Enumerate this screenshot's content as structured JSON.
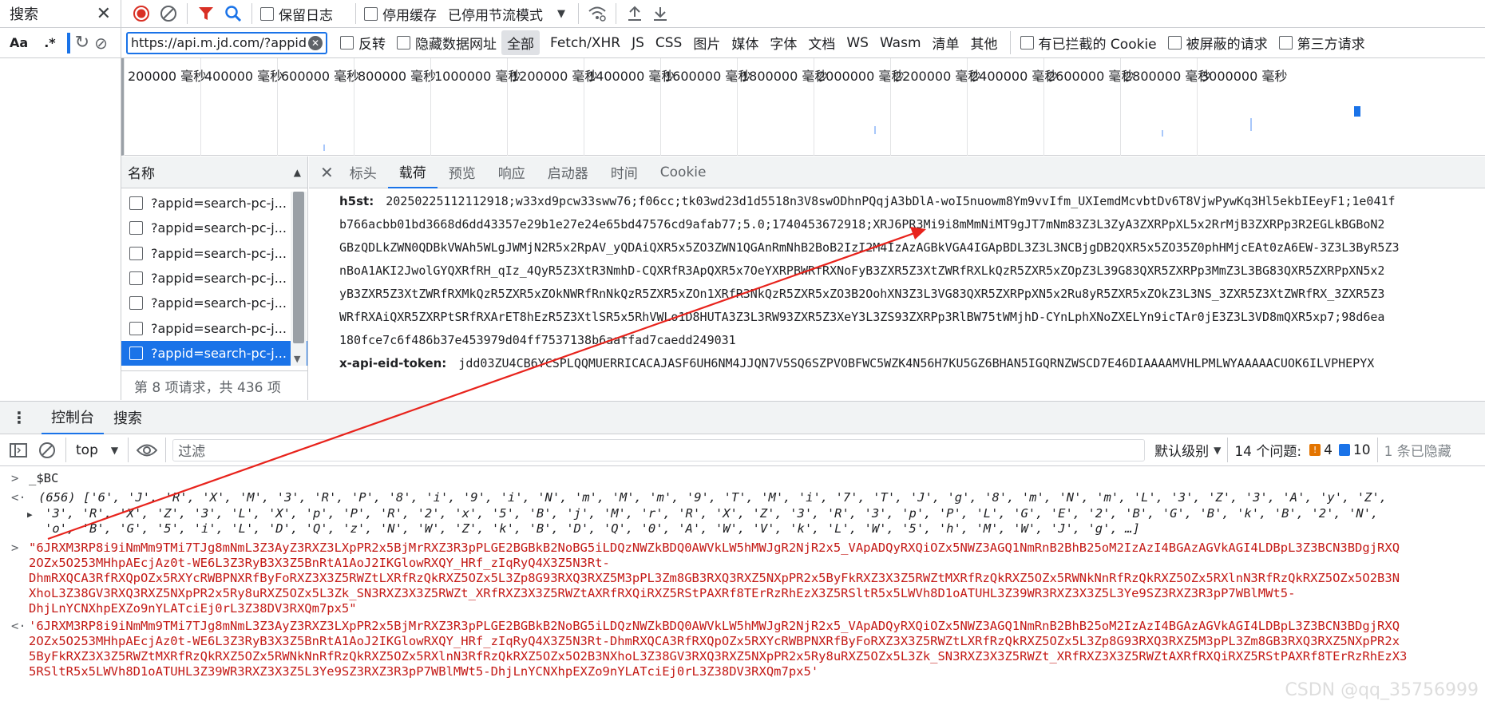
{
  "search_panel": {
    "title": "搜索",
    "case_label": "Aa",
    "regex_label": ".*"
  },
  "toolbar": {
    "preserve_log": "保留日志",
    "disable_cache": "停用缓存",
    "throttling": "已停用节流模式"
  },
  "filter_bar": {
    "url_value": "https://api.m.jd.com/?appid",
    "invert": "反转",
    "hide_data_urls": "隐藏数据网址",
    "types": [
      "全部",
      "Fetch/XHR",
      "JS",
      "CSS",
      "图片",
      "媒体",
      "字体",
      "文档",
      "WS",
      "Wasm",
      "清单",
      "其他"
    ],
    "blocked_cookies": "有已拦截的 Cookie",
    "blocked_requests": "被屏蔽的请求",
    "third_party": "第三方请求"
  },
  "timeline": {
    "ticks": [
      "200000 毫秒",
      "400000 毫秒",
      "600000 毫秒",
      "800000 毫秒",
      "1000000 毫秒",
      "1200000 毫秒",
      "1400000 毫秒",
      "1600000 毫秒",
      "1800000 毫秒",
      "2000000 毫秒",
      "2200000 毫秒",
      "2400000 毫秒",
      "2600000 毫秒",
      "2800000 毫秒",
      "3000000 毫秒"
    ]
  },
  "request_list": {
    "header": "名称",
    "rows": [
      "?appid=search-pc-j...",
      "?appid=search-pc-j...",
      "?appid=search-pc-j...",
      "?appid=search-pc-j...",
      "?appid=search-pc-j...",
      "?appid=search-pc-j...",
      "?appid=search-pc-j..."
    ],
    "footer": "第 8 项请求，共 436 项"
  },
  "detail": {
    "tabs": [
      "标头",
      "载荷",
      "预览",
      "响应",
      "启动器",
      "时间",
      "Cookie"
    ],
    "h5st_key": "h5st:",
    "h5st_lines": [
      "20250225112112918;w33xd9pcw33sww76;f06cc;tk03wd23d1d5518n3V8swODhnPQqjA3bDlA-woI5nuowm8Ym9vvIfm_UXIemdMcvbtDv6T8VjwPywKq3Hl5ekbIEeyF1;1e041f",
      "b766acbb01bd3668d6dd43357e29b1e27e24e65bd47576cd9afab77;5.0;1740453672918;XRJ6PR3Mi9i8mMmNiMT9gJT7mNm83Z3L3ZyA3ZXRPpXL5x2RrMjB3ZXRPp3R2EGLkBGBoN2",
      "GBzQDLkZWN0QDBkVWAh5WLgJWMjN2R5x2RpAV_yQDAiQXR5x5ZO3ZWN1QGAnRmNhB2BoB2IzI2M4IzAzAGBkVGA4IGApBDL3Z3L3NCBjgDB2QXR5x5ZO35Z0phHMjcEAt0zA6EW-3Z3L3ByR5Z3",
      "nBoA1AKI2JwolGYQXRfRH_qIz_4QyR5Z3XtR3NmhD-CQXRfR3ApQXR5x7OeYXRPBWRfRXNoFyB3ZXR5Z3XtZWRfRXLkQzR5ZXR5xZOpZ3L39G83QXR5ZXRPp3MmZ3L3BG83QXR5ZXRPpXN5x2",
      "yB3ZXR5Z3XtZWRfRXMkQzR5ZXR5xZOkNWRfRnNkQzR5ZXR5xZOn1XRfR3NkQzR5ZXR5xZO3B2OohXN3Z3L3VG83QXR5ZXRPpXN5x2Ru8yR5ZXR5xZOkZ3L3NS_3ZXR5Z3XtZWRfRX_3ZXR5Z3",
      "WRfRXAiQXR5ZXRPtSRfRXArET8hEzR5Z3XtlSR5x5RhVWLo1D8HUTA3Z3L3RW93ZXR5Z3XeY3L3ZS93ZXRPp3RlBW75tWMjhD-CYnLphXNoZXELYn9icTAr0jE3Z3L3VD8mQXR5xp7;98d6ea",
      "180fce7c6f486b37e453979d04ff7537138b6aaffad7caedd249031"
    ],
    "eid_key": "x-api-eid-token:",
    "eid_value": "jdd03ZU4CB6YCSPLQQMUERRICACAJASF6UH6NM4JJQN7V5SQ6SZPVOBFWC5WZK4N56H7KU5GZ6BHAN5IGQRNZWSCD7E46DIAAAAMVHLPMLWYAAAAACUOK6ILVPHEPYX"
  },
  "drawer": {
    "tabs": [
      "控制台",
      "搜索"
    ]
  },
  "console_toolbar": {
    "context": "top",
    "filter_placeholder": "过滤",
    "level": "默认级别",
    "issues_label": "14 个问题:",
    "warn_count": "4",
    "info_count": "10",
    "hidden": "1 条已隐藏"
  },
  "console": {
    "input1": "_$BC",
    "array_head": "(656) ['6', 'J', 'R', 'X', 'M', '3', 'R', 'P', '8', 'i', '9', 'i', 'N', 'm', 'M', 'm', '9', 'T', 'M', 'i', '7', 'T', 'J', 'g', '8', 'm', 'N', 'm', 'L', '3', 'Z', '3', 'A', 'y', 'Z',",
    "array_l2": "'3', 'R', 'X', 'Z', '3', 'L', 'X', 'p', 'P', 'R', '2', 'x', '5', 'B', 'j', 'M', 'r', 'R', 'X', 'Z', '3', 'R', '3', 'p', 'P', 'L', 'G', 'E', '2', 'B', 'G', 'B', 'k', 'B', '2', 'N',",
    "array_l3": "'o', 'B', 'G', '5', 'i', 'L', 'D', 'Q', 'z', 'N', 'W', 'Z', 'k', 'B', 'D', 'Q', '0', 'A', 'W', 'V', 'k', 'L', 'W', '5', 'h', 'M', 'W', 'J', 'g', …]",
    "str1_lines": [
      "\"6JRXM3RP8i9iNmMm9TMi7TJg8mNmL3Z3AyZ3RXZ3LXpPR2x5BjMrRXZ3R3pPLGE2BGBkB2NoBG5iLDQzNWZkBDQ0AWVkLW5hMWJgR2NjR2x5_VApADQyRXQiOZx5NWZ3AGQ1NmRnB2BhB25oM2IzAzI4BGAzAGVkAGI4LDBpL3Z3BCN3BDgjRXQ",
      "2OZx5O253MHhpAEcjAz0t-WE6L3Z3RyB3X3Z5BnRtA1AoJ2IKGlowRXQY_HRf_zIqRyQ4X3Z5N3Rt-",
      "DhmRXQCA3RfRXQpOZx5RXYcRWBPNXRfByFoRXZ3X3Z5RWZtLXRfRzQkRXZ5OZx5L3Zp8G93RXQ3RXZ5M3pPL3Zm8GB3RXQ3RXZ5NXpPR2x5ByFkRXZ3X3Z5RWZtMXRfRzQkRXZ5OZx5RWNkNnRfRzQkRXZ5OZx5RXlnN3RfRzQkRXZ5OZx5O2B3N",
      "XhoL3Z38GV3RXQ3RXZ5NXpPR2x5Ry8uRXZ5OZx5L3Zk_SN3RXZ3X3Z5RWZt_XRfRXZ3X3Z5RWZtAXRfRXQiRXZ5RStPAXRf8TErRzRhEzX3Z5RSltR5x5LWVh8D1oATUHL3Z39WR3RXZ3X3Z5L3Ye9SZ3RXZ3R3pP7WBlMWt5-",
      "DhjLnYCNXhpEXZo9nYLATciEj0rL3Z38DV3RXQm7px5\""
    ],
    "str2_lines": [
      "'6JRXM3RP8i9iNmMm9TMi7TJg8mNmL3Z3AyZ3RXZ3LXpPR2x5BjMrRXZ3R3pPLGE2BGBkB2NoBG5iLDQzNWZkBDQ0AWVkLW5hMWJgR2NjR2x5_VApADQyRXQiOZx5NWZ3AGQ1NmRnB2BhB25oM2IzAzI4BGAzAGVkAGI4LDBpL3Z3BCN3BDgjRXQ",
      "2OZx5O253MHhpAEcjAz0t-WE6L3Z3RyB3X3Z5BnRtA1AoJ2IKGlowRXQY_HRf_zIqRyQ4X3Z5N3Rt-DhmRXQCA3RfRXQpOZx5RXYcRWBPNXRfByFoRXZ3X3Z5RWZtLXRfRzQkRXZ5OZx5L3Zp8G93RXQ3RXZ5M3pPL3Zm8GB3RXQ3RXZ5NXpPR2x",
      "5ByFkRXZ3X3Z5RWZtMXRfRzQkRXZ5OZx5RWNkNnRfRzQkRXZ5OZx5RXlnN3RfRzQkRXZ5OZx5O2B3NXhoL3Z38GV3RXQ3RXZ5NXpPR2x5Ry8uRXZ5OZx5L3Zk_SN3RXZ3X3Z5RWZt_XRfRXZ3X3Z5RWZtAXRfRXQiRXZ5RStPAXRf8TErRzRhEzX3",
      "5RSltR5x5LWVh8D1oATUHL3Z39WR3RXZ3X3Z5L3Ye9SZ3RXZ3R3pP7WBlMWt5-DhjLnYCNXhpEXZo9nYLATciEj0rL3Z38DV3RXQm7px5'"
    ]
  },
  "watermark": "CSDN @qq_35756999",
  "colors": {
    "accent": "#1a73e8",
    "record": "#d93025",
    "string": "#c41a16",
    "arrow": "#e8231c"
  }
}
